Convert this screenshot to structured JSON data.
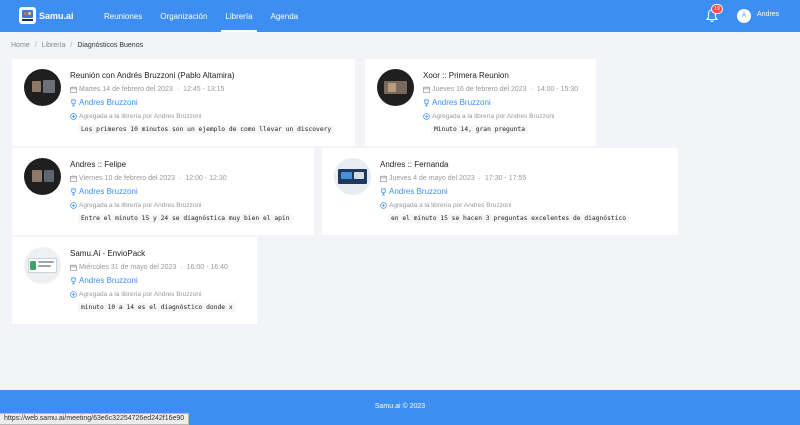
{
  "app": {
    "name": "Samu.ai"
  },
  "nav": {
    "links": [
      "Reuniones",
      "Organización",
      "Librería",
      "Agenda"
    ],
    "active": "Librería"
  },
  "notifications": {
    "count": "19"
  },
  "user": {
    "initial": "A",
    "name": "Andres"
  },
  "breadcrumb": [
    "Home",
    "Librería",
    "Diagnósticos Buenos"
  ],
  "cards": [
    {
      "title": "Reunión con Andrés Bruzzoni (Pablo Altamira)",
      "date": "Martes 14 de febrero del 2023",
      "time": "12:45 - 13:15",
      "owner": "Andres Bruzzoni",
      "added_by": "Agregada a la librería por Andres Bruzzoni",
      "note": "Los primeros 10 minutos son un ejemplo de como llevar un discovery"
    },
    {
      "title": "Xoor :: Primera Reunion",
      "date": "Jueves 16 de febrero del 2023",
      "time": "14:00 - 15:30",
      "owner": "Andres Bruzzoni",
      "added_by": "Agregada a la librería por Andres Bruzzoni",
      "note": "Minuto 14, gran pregunta"
    },
    {
      "title": "Andres :: Felipe",
      "date": "Viernes 10 de febrero del 2023",
      "time": "12:00 - 12:30",
      "owner": "Andres Bruzzoni",
      "added_by": "Agregada a la librería por Andres Bruzzoni",
      "note": "Entre el minuto 15 y 24 se diagnóstica muy bien el apin"
    },
    {
      "title": "Andres :: Fernanda",
      "date": "Jueves 4 de mayo del 2023",
      "time": "17:30 - 17:55",
      "owner": "Andres Bruzzoni",
      "added_by": "Agregada a la librería por Andres Bruzzoni",
      "note": "en el minuto 15 se hacen 3 preguntas excelentes de diagnóstico"
    },
    {
      "title": "Samu.Ai - EnvioPack",
      "date": "Miércoles 31 de mayo del 2023",
      "time": "16:00 - 16:40",
      "owner": "Andres Bruzzoni",
      "added_by": "Agregada a la librería por Andres Bruzzoni",
      "note": "minuto 10 a 14 es el diagnóstico donde x"
    }
  ],
  "footer": {
    "text": "Samu.ai © 2023"
  },
  "status_bar": {
    "url": "https://web.samu.ai/meeting/63e6c32254726ed242f16e90"
  },
  "colors": {
    "primary": "#3d8ef0",
    "background": "#f2f4f7",
    "badge": "#ff4d4f"
  }
}
